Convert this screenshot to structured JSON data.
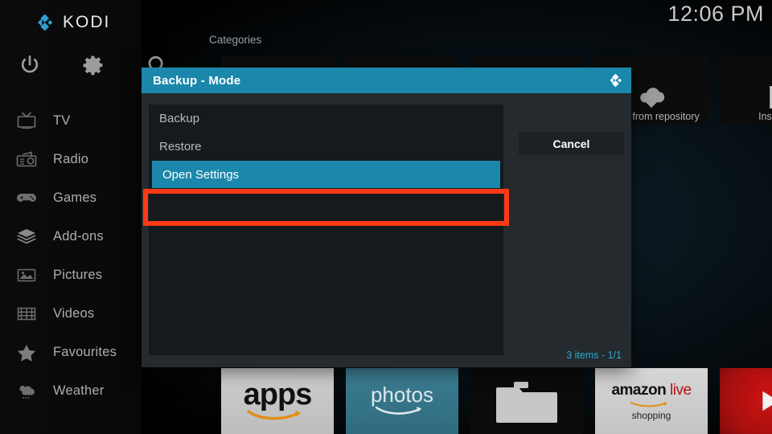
{
  "app": {
    "brand": "KODI",
    "clock": "12:06 PM"
  },
  "topbar": {
    "power_icon": "power-icon",
    "settings_icon": "gear-icon",
    "search_icon": "search-icon"
  },
  "sidebar": {
    "items": [
      {
        "label": "TV",
        "icon": "tv-icon"
      },
      {
        "label": "Radio",
        "icon": "radio-icon"
      },
      {
        "label": "Games",
        "icon": "gamepad-icon"
      },
      {
        "label": "Add-ons",
        "icon": "addons-box-icon"
      },
      {
        "label": "Pictures",
        "icon": "pictures-icon"
      },
      {
        "label": "Videos",
        "icon": "film-strip-icon"
      },
      {
        "label": "Favourites",
        "icon": "star-icon"
      },
      {
        "label": "Weather",
        "icon": "cloud-weather-icon"
      }
    ]
  },
  "main": {
    "section_label": "Categories",
    "top_tiles": [
      {
        "label": "",
        "icon": ""
      },
      {
        "label": "",
        "icon": ""
      },
      {
        "label": "",
        "icon": ""
      },
      {
        "label": "Install from repository",
        "icon": "cloud-download-icon"
      },
      {
        "label": "Install fr",
        "icon": "zip-file-icon"
      }
    ],
    "bottom_tiles": [
      {
        "label": "apps",
        "icon": "amazon-smile-icon"
      },
      {
        "label": "photos",
        "icon": "amazon-smile-icon"
      },
      {
        "label": "",
        "icon": "folder-icon"
      },
      {
        "label": "amazon live",
        "sublabel": "shopping",
        "icon": "amazon-smile-icon"
      },
      {
        "label": "",
        "icon": "play-button-icon"
      }
    ]
  },
  "dialog": {
    "title": "Backup - Mode",
    "logo_icon": "kodi-logo-icon",
    "options": [
      {
        "label": "Backup",
        "selected": false
      },
      {
        "label": "Restore",
        "selected": false
      },
      {
        "label": "Open Settings",
        "selected": true
      }
    ],
    "cancel_label": "Cancel",
    "count_text": "3 items - ",
    "count_page": "1/1"
  },
  "annotation": {
    "target": "Open Settings",
    "color": "#fc3a17"
  },
  "colors": {
    "accent_teal": "#1b87ab",
    "panel": "#161a1c",
    "dialog_bg": "#242a2e",
    "annotation_red": "#fc3a17"
  }
}
